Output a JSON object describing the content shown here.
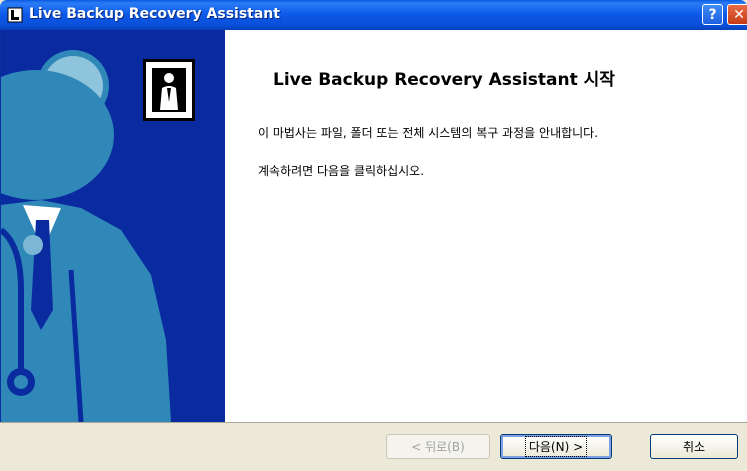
{
  "window": {
    "title": "Live Backup Recovery Assistant",
    "help_label": "?",
    "close_label": "✕"
  },
  "wizard": {
    "heading": "Live Backup Recovery Assistant 시작",
    "description": "이 마법사는 파일, 폴더 또는 전체 시스템의 복구 과정을 안내합니다.",
    "instruction": "계속하려면 다음을 클릭하십시오."
  },
  "buttons": {
    "back": "< 뒤로(B)",
    "next": "다음(N) >",
    "cancel": "취소"
  },
  "colors": {
    "title_bar": "#0a4fd8",
    "side_panel": "#0a2ba0",
    "doctor_figure": "#2f88b8",
    "dialog_bg": "#ece9d8"
  }
}
